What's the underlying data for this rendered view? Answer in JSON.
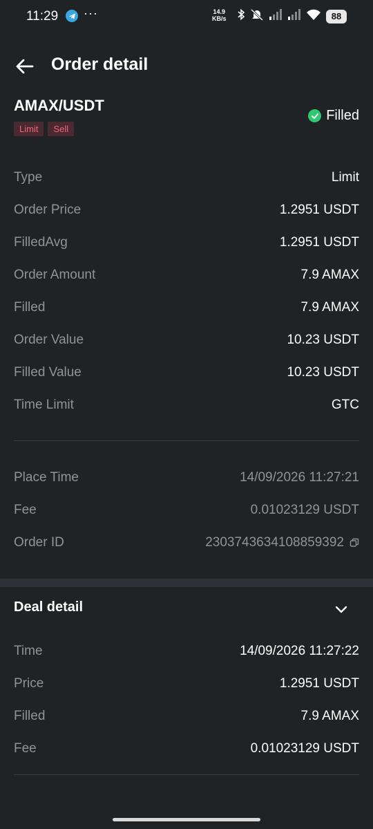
{
  "status_bar": {
    "time": "11:29",
    "dots": "···",
    "speed_value": "14.9",
    "speed_unit": "KB/s",
    "battery": "88"
  },
  "header": {
    "title": "Order detail"
  },
  "order": {
    "pair": "AMAX/USDT",
    "tags": [
      "Limit",
      "Sell"
    ],
    "status": "Filled",
    "details": [
      {
        "label": "Type",
        "value": "Limit"
      },
      {
        "label": "Order Price",
        "value": "1.2951 USDT"
      },
      {
        "label": "FilledAvg",
        "value": "1.2951 USDT"
      },
      {
        "label": "Order Amount",
        "value": "7.9 AMAX"
      },
      {
        "label": "Filled",
        "value": "7.9 AMAX"
      },
      {
        "label": "Order Value",
        "value": "10.23 USDT"
      },
      {
        "label": "Filled Value",
        "value": "10.23 USDT"
      },
      {
        "label": "Time Limit",
        "value": "GTC"
      }
    ],
    "meta": [
      {
        "label": "Place Time",
        "value": "14/09/2026 11:27:21"
      },
      {
        "label": "Fee",
        "value": "0.01023129 USDT"
      },
      {
        "label": "Order ID",
        "value": "2303743634108859392"
      }
    ]
  },
  "deal_detail": {
    "title": "Deal detail",
    "rows": [
      {
        "label": "Time",
        "value": "14/09/2026 11:27:22"
      },
      {
        "label": "Price",
        "value": "1.2951 USDT"
      },
      {
        "label": "Filled",
        "value": "7.9 AMAX"
      },
      {
        "label": "Fee",
        "value": "0.01023129 USDT"
      }
    ]
  },
  "colors": {
    "background": "#1f2326",
    "tag_bg": "#4a2a30",
    "tag_text": "#f0657b",
    "filled_green": "#2fc76f",
    "label_gray": "#8d949a"
  }
}
